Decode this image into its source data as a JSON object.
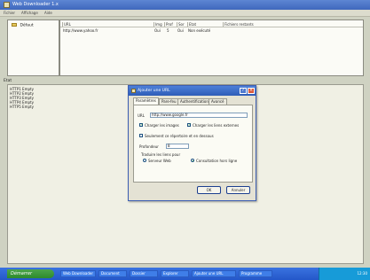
{
  "window": {
    "title": "Web Downloader 1.x"
  },
  "menu": {
    "items": [
      "Fichier",
      "Affichage",
      "Aide"
    ]
  },
  "folders": {
    "items": [
      {
        "label": "Défaut"
      }
    ]
  },
  "urls": {
    "columns": [
      "URL",
      "Img",
      "Prof",
      "Sor",
      "Etat",
      "Fichiers restants"
    ],
    "rows": [
      {
        "url": "http://www.yahoo.fr",
        "img": "Oui",
        "prof": "5",
        "sor": "Oui",
        "etat": "Non exécuté",
        "remaining": ""
      }
    ]
  },
  "status": {
    "label": "Etat",
    "lines": [
      "HTTP1 Empty",
      "HTTP2 Empty",
      "HTTP3 Empty",
      "HTTP4 Empty",
      "HTTP5 Empty"
    ]
  },
  "dialog": {
    "title": "Ajouter une URL",
    "tabs": [
      "Paramètres",
      "Pare-feu",
      "Authentification",
      "Avancé"
    ],
    "url_label": "URL",
    "url_value": "http://www.google.fr",
    "charger_images": "Charger les images",
    "charger_liens": "Charger les liens externes",
    "seulement_repertoire": "Seulement ce répertoire et en dessous",
    "profondeur_label": "Profondeur",
    "profondeur_value": "8",
    "traduire_label": "Traduire les liens pour",
    "service_web": "Serveur Web",
    "consultation": "Consultation hors ligne",
    "ok": "OK",
    "annuler": "Annuler"
  },
  "taskbar": {
    "start": "Démarrer",
    "tasks": [
      "Web Downloader",
      "Document",
      "Dossier",
      "Explorer",
      "Ajouter une URL",
      "Programme"
    ],
    "tray_time": "12:30"
  }
}
